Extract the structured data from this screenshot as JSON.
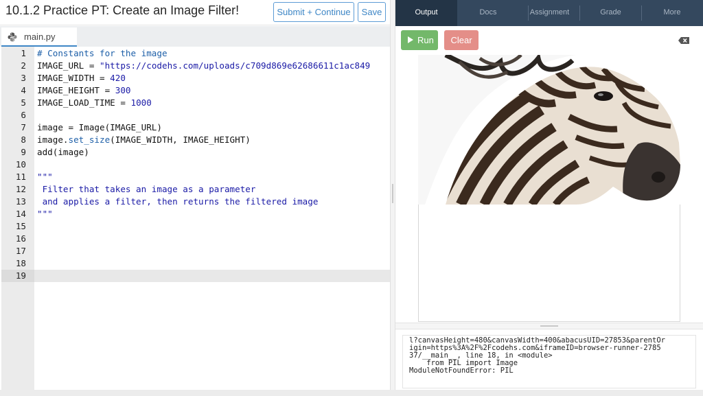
{
  "header": {
    "title": "10.1.2 Practice PT: Create an Image Filter!",
    "submit_label": "Submit + Continue",
    "save_label": "Save"
  },
  "file_tabs": [
    {
      "name": "main.py",
      "icon": "python-icon"
    }
  ],
  "editor": {
    "active_line": 19,
    "line_numbers": [
      "1",
      "2",
      "3",
      "4",
      "5",
      "6",
      "7",
      "8",
      "9",
      "10",
      "11",
      "12",
      "13",
      "14",
      "15",
      "16",
      "17",
      "18",
      "19"
    ],
    "lines": [
      [
        {
          "t": "# Constants for the image",
          "c": "#1d5fa8"
        }
      ],
      [
        {
          "t": "IMAGE_URL = ",
          "c": "#111"
        },
        {
          "t": "\"https://codehs.com/uploads/c709d869e62686611c1ac849",
          "c": "#1a1aa6"
        }
      ],
      [
        {
          "t": "IMAGE_WIDTH = ",
          "c": "#111"
        },
        {
          "t": "420",
          "c": "#1a1aa6"
        }
      ],
      [
        {
          "t": "IMAGE_HEIGHT = ",
          "c": "#111"
        },
        {
          "t": "300",
          "c": "#1a1aa6"
        }
      ],
      [
        {
          "t": "IMAGE_LOAD_TIME = ",
          "c": "#111"
        },
        {
          "t": "1000",
          "c": "#1a1aa6"
        }
      ],
      [],
      [
        {
          "t": "image = Image(IMAGE_URL)",
          "c": "#111"
        }
      ],
      [
        {
          "t": "image.",
          "c": "#111"
        },
        {
          "t": "set_size",
          "c": "#1d5fa8"
        },
        {
          "t": "(IMAGE_WIDTH, IMAGE_HEIGHT)",
          "c": "#111"
        }
      ],
      [
        {
          "t": "add(image)",
          "c": "#111"
        }
      ],
      [],
      [
        {
          "t": "\"\"\"",
          "c": "#1a1aa6"
        }
      ],
      [
        {
          "t": " Filter that takes an image as a parameter",
          "c": "#1a1aa6"
        }
      ],
      [
        {
          "t": " and applies a filter, then returns the filtered image",
          "c": "#1a1aa6"
        }
      ],
      [
        {
          "t": "\"\"\"",
          "c": "#1a1aa6"
        }
      ],
      [],
      [],
      [],
      [],
      []
    ]
  },
  "right_tabs": [
    "Output",
    "Docs",
    "Assignment",
    "Grade",
    "More"
  ],
  "output": {
    "run_label": "Run",
    "clear_label": "Clear",
    "console_lines": [
      "l?canvasHeight=480&canvasWidth=400&abacusUID=27853&parentOr",
      "igin=https%3A%2F%2Fcodehs.com&iframeID=browser-runner-2785",
      "37/__main__, line 18, in <module>",
      "    from PIL import Image",
      "ModuleNotFoundError: PIL"
    ]
  },
  "colors": {
    "accent_blue": "#3d86c6",
    "run_green": "#73b86a",
    "clear_red": "#e48e88",
    "nav_bg": "#34485e",
    "nav_active": "#233446"
  }
}
